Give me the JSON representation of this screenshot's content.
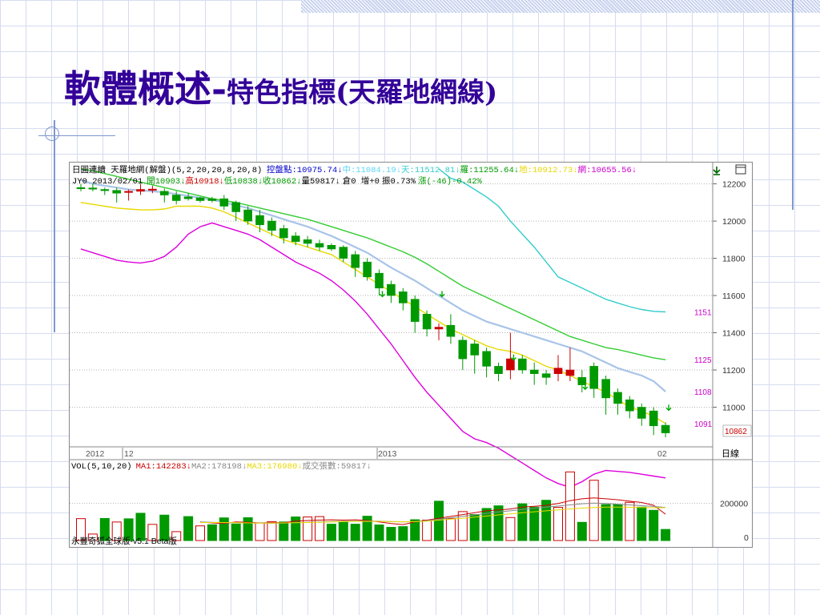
{
  "slide": {
    "title_main": "軟體概述-",
    "title_sub": "特色指標(天羅地網線)"
  },
  "indicator": {
    "name": "日圓連續 天羅地網(解盤)(5,2,20,20,8,20,8)",
    "values": [
      {
        "label": "控盤點:10975.74↓",
        "color": "#0000cc"
      },
      {
        "label": "中:11084.19↓",
        "color": "#5dd5f5"
      },
      {
        "label": "天:11512.81↓",
        "color": "#33cccc"
      },
      {
        "label": "羅:11255.64↓",
        "color": "#009900"
      },
      {
        "label": "地:10912.73↓",
        "color": "#e8d800"
      },
      {
        "label": "網:10655.56↓",
        "color": "#cc00cc"
      }
    ]
  },
  "quote": {
    "symbol_date": "JY0 2013/02/01",
    "values": [
      {
        "label": "開10903↓",
        "color": "#009900"
      },
      {
        "label": "高10918↓",
        "color": "#cc0000"
      },
      {
        "label": "低10838↓",
        "color": "#009900"
      },
      {
        "label": "收10862↓",
        "color": "#009900"
      },
      {
        "label": "量59817↓",
        "color": "#000000"
      },
      {
        "label": "倉0 增+0",
        "color": "#000000"
      },
      {
        "label": "振0.73%",
        "color": "#000000"
      },
      {
        "label": "漲(-46)-0.42%",
        "color": "#009900"
      }
    ]
  },
  "toolbar": {
    "collapse_icon": "download-arrow-icon",
    "window_icon": "window-icon",
    "daily_label": "日線"
  },
  "time_labels": [
    "2012",
    "12",
    "2013",
    "02"
  ],
  "volume_header": {
    "values": [
      {
        "label": "VOL(5,10,20)",
        "color": "#000000"
      },
      {
        "label": "MA1:142283↓",
        "color": "#cc0000"
      },
      {
        "label": "MA2:178198↓",
        "color": "#888888"
      },
      {
        "label": "MA3:176980↓",
        "color": "#e8d800"
      },
      {
        "label": "成交張數:59817↓",
        "color": "#888888"
      }
    ]
  },
  "footer_text": "永豐奇狐全球版-v5.1 Beta版",
  "price_markers": [
    {
      "label": "1151",
      "value": 11512,
      "color": "#cc00cc"
    },
    {
      "label": "1125",
      "value": 11255,
      "color": "#cc00cc"
    },
    {
      "label": "1108",
      "value": 11084,
      "color": "#cc00cc"
    },
    {
      "label": "1091",
      "value": 10912,
      "color": "#cc00cc"
    }
  ],
  "last_price_label": "10862",
  "colors": {
    "up_candle": "#cc0000",
    "down_candle": "#009900",
    "title": "#330099"
  },
  "chart_data": [
    {
      "type": "candlestick",
      "title": "日圓連續 天羅地網(解盤)(5,2,20,20,8,20,8)",
      "y_ticks": [
        11000,
        11200,
        11400,
        11600,
        11800,
        12000,
        12200
      ],
      "ylim": [
        10800,
        12280
      ],
      "ohlc": [
        [
          12180,
          12200,
          12160,
          12175
        ],
        [
          12178,
          12200,
          12160,
          12175
        ],
        [
          12170,
          12180,
          12140,
          12165
        ],
        [
          12165,
          12180,
          12100,
          12150
        ],
        [
          12155,
          12170,
          12110,
          12160
        ],
        [
          12160,
          12200,
          12140,
          12170
        ],
        [
          12170,
          12190,
          12150,
          12172
        ],
        [
          12160,
          12175,
          12100,
          12140
        ],
        [
          12140,
          12160,
          12090,
          12110
        ],
        [
          12130,
          12150,
          12110,
          12120
        ],
        [
          12125,
          12130,
          12100,
          12110
        ],
        [
          12120,
          12130,
          12100,
          12110
        ],
        [
          12120,
          12140,
          12060,
          12080
        ],
        [
          12100,
          12110,
          12000,
          12050
        ],
        [
          12060,
          12080,
          11980,
          12000
        ],
        [
          12030,
          12060,
          11940,
          11980
        ],
        [
          12000,
          12020,
          11920,
          11950
        ],
        [
          11960,
          11980,
          11880,
          11910
        ],
        [
          11920,
          11940,
          11870,
          11890
        ],
        [
          11900,
          11920,
          11860,
          11880
        ],
        [
          11880,
          11900,
          11840,
          11860
        ],
        [
          11870,
          11880,
          11840,
          11850
        ],
        [
          11860,
          11870,
          11780,
          11800
        ],
        [
          11820,
          11840,
          11700,
          11750
        ],
        [
          11780,
          11800,
          11680,
          11700
        ],
        [
          11720,
          11740,
          11600,
          11640
        ],
        [
          11660,
          11680,
          11560,
          11600
        ],
        [
          11620,
          11640,
          11520,
          11560
        ],
        [
          11580,
          11600,
          11400,
          11460
        ],
        [
          11500,
          11520,
          11380,
          11420
        ],
        [
          11420,
          11450,
          11360,
          11430
        ],
        [
          11440,
          11500,
          11340,
          11380
        ],
        [
          11360,
          11380,
          11200,
          11260
        ],
        [
          11340,
          11360,
          11180,
          11280
        ],
        [
          11300,
          11320,
          11160,
          11220
        ],
        [
          11220,
          11240,
          11140,
          11180
        ],
        [
          11200,
          11400,
          11150,
          11260
        ],
        [
          11260,
          11280,
          11180,
          11200
        ],
        [
          11200,
          11240,
          11120,
          11180
        ],
        [
          11180,
          11200,
          11120,
          11160
        ],
        [
          11180,
          11280,
          11140,
          11210
        ],
        [
          11170,
          11320,
          11140,
          11200
        ],
        [
          11160,
          11200,
          11080,
          11120
        ],
        [
          11220,
          11240,
          11050,
          11100
        ],
        [
          11150,
          11170,
          10960,
          11050
        ],
        [
          11080,
          11100,
          10960,
          11020
        ],
        [
          11040,
          11060,
          10940,
          10980
        ],
        [
          11000,
          11020,
          10900,
          10940
        ],
        [
          10980,
          11000,
          10850,
          10900
        ],
        [
          10903,
          10918,
          10838,
          10862
        ]
      ],
      "series": [
        {
          "name": "中",
          "color": "#a8c4e8",
          "values": [
            12220,
            12200,
            12190,
            12180,
            12170,
            12165,
            12160,
            12155,
            12145,
            12135,
            12125,
            12115,
            12100,
            12085,
            12070,
            12050,
            12030,
            12010,
            11990,
            11970,
            11945,
            11920,
            11890,
            11860,
            11830,
            11790,
            11750,
            11715,
            11680,
            11640,
            11600,
            11560,
            11520,
            11490,
            11460,
            11440,
            11420,
            11400,
            11380,
            11360,
            11340,
            11320,
            11300,
            11270,
            11240,
            11210,
            11190,
            11170,
            11140,
            11084
          ]
        },
        {
          "name": "天",
          "color": "#33cccc",
          "values": [
            null,
            null,
            null,
            null,
            null,
            null,
            null,
            null,
            null,
            null,
            null,
            null,
            null,
            null,
            null,
            null,
            null,
            null,
            null,
            null,
            null,
            null,
            null,
            null,
            null,
            null,
            null,
            null,
            null,
            null,
            12280,
            12230,
            12210,
            12170,
            12130,
            12080,
            12000,
            11930,
            11860,
            11780,
            11700,
            11670,
            11640,
            11610,
            11580,
            11560,
            11540,
            11525,
            11515,
            11512
          ]
        },
        {
          "name": "羅",
          "color": "#33cc33",
          "values": [
            12280,
            12270,
            12255,
            12240,
            12225,
            12210,
            12195,
            12180,
            12165,
            12150,
            12135,
            12120,
            12110,
            12100,
            12085,
            12070,
            12055,
            12040,
            12025,
            12010,
            11990,
            11970,
            11950,
            11930,
            11910,
            11885,
            11860,
            11835,
            11805,
            11770,
            11730,
            11690,
            11650,
            11620,
            11590,
            11560,
            11530,
            11500,
            11470,
            11440,
            11410,
            11380,
            11360,
            11340,
            11320,
            11310,
            11295,
            11280,
            11265,
            11255
          ]
        },
        {
          "name": "地",
          "color": "#e8d800",
          "values": [
            12100,
            12090,
            12080,
            12070,
            12065,
            12060,
            12060,
            12065,
            12080,
            12080,
            12080,
            12070,
            12050,
            12020,
            11990,
            11960,
            11930,
            11900,
            11880,
            11860,
            11840,
            11820,
            11780,
            11740,
            11700,
            11660,
            11620,
            11580,
            11540,
            11500,
            11460,
            11420,
            11390,
            11360,
            11330,
            11310,
            11300,
            11280,
            11250,
            11220,
            11200,
            11170,
            11140,
            11110,
            11080,
            11040,
            11000,
            10980,
            10950,
            10913
          ]
        },
        {
          "name": "網",
          "color": "#dd00dd",
          "values": [
            11850,
            11830,
            11810,
            11790,
            11780,
            11775,
            11785,
            11810,
            11860,
            11930,
            11970,
            11990,
            11970,
            11950,
            11930,
            11900,
            11860,
            11820,
            11780,
            11750,
            11720,
            11680,
            11630,
            11570,
            11500,
            11420,
            11340,
            11250,
            11160,
            11080,
            11010,
            10940,
            10870,
            10830,
            10810,
            10780,
            10740,
            10700,
            10660,
            10620,
            10590,
            10570,
            10600,
            10640,
            10660,
            10655,
            10650,
            10640,
            10630,
            10620
          ]
        }
      ]
    },
    {
      "type": "bar",
      "title": "VOL(5,10,20)",
      "y_ticks": [
        0,
        200000
      ],
      "ylim": [
        0,
        380000
      ],
      "values": [
        118000,
        35000,
        119000,
        100000,
        117000,
        147000,
        87000,
        137000,
        48000,
        129000,
        79000,
        85000,
        122000,
        89000,
        123000,
        95000,
        102000,
        100000,
        127000,
        127000,
        129000,
        88000,
        102000,
        88000,
        131000,
        84000,
        71000,
        75000,
        112000,
        110000,
        212000,
        118000,
        156000,
        140000,
        173000,
        187000,
        124000,
        198000,
        180000,
        217000,
        179000,
        370000,
        98000,
        325000,
        194000,
        194000,
        206000,
        180000,
        163000,
        59817
      ],
      "up": [
        true,
        true,
        false,
        true,
        false,
        false,
        true,
        false,
        true,
        false,
        true,
        false,
        false,
        false,
        false,
        true,
        true,
        false,
        false,
        true,
        true,
        false,
        false,
        false,
        false,
        false,
        false,
        false,
        false,
        true,
        false,
        true,
        true,
        false,
        false,
        false,
        true,
        false,
        false,
        false,
        true,
        true,
        false,
        true,
        false,
        false,
        true,
        false,
        false,
        false
      ],
      "series": [
        {
          "name": "MA1",
          "color": "#cc0000",
          "values": [
            null,
            null,
            null,
            null,
            null,
            null,
            null,
            null,
            null,
            null,
            100000,
            95000,
            92000,
            100000,
            98000,
            95000,
            96000,
            96000,
            105000,
            108000,
            110000,
            112000,
            110000,
            112000,
            108000,
            100000,
            92000,
            86000,
            100000,
            110000,
            120000,
            130000,
            140000,
            150000,
            160000,
            165000,
            170000,
            180000,
            185000,
            190000,
            200000,
            215000,
            225000,
            230000,
            225000,
            220000,
            212000,
            205000,
            190000,
            142283
          ]
        },
        {
          "name": "MA2",
          "color": "#888888",
          "values": [
            null,
            null,
            null,
            null,
            null,
            null,
            null,
            null,
            null,
            null,
            100000,
            98000,
            96000,
            96000,
            95000,
            94000,
            93000,
            94000,
            96000,
            98000,
            100000,
            102000,
            104000,
            105000,
            105000,
            104000,
            102000,
            100000,
            102000,
            108000,
            115000,
            122000,
            130000,
            138000,
            146000,
            154000,
            160000,
            168000,
            175000,
            180000,
            186000,
            192000,
            198000,
            202000,
            200000,
            196000,
            192000,
            188000,
            184000,
            178198
          ]
        },
        {
          "name": "MA3",
          "color": "#e8d800",
          "values": [
            null,
            null,
            null,
            null,
            null,
            null,
            null,
            null,
            null,
            null,
            97000,
            97000,
            97000,
            96000,
            95000,
            94000,
            94000,
            95000,
            96000,
            97000,
            99000,
            100000,
            102000,
            103000,
            103000,
            103000,
            102000,
            101000,
            102000,
            104000,
            110000,
            115000,
            120000,
            126000,
            132000,
            138000,
            144000,
            150000,
            155000,
            160000,
            165000,
            170000,
            175000,
            178000,
            180000,
            180000,
            179000,
            178000,
            177000,
            176980
          ]
        }
      ]
    }
  ]
}
